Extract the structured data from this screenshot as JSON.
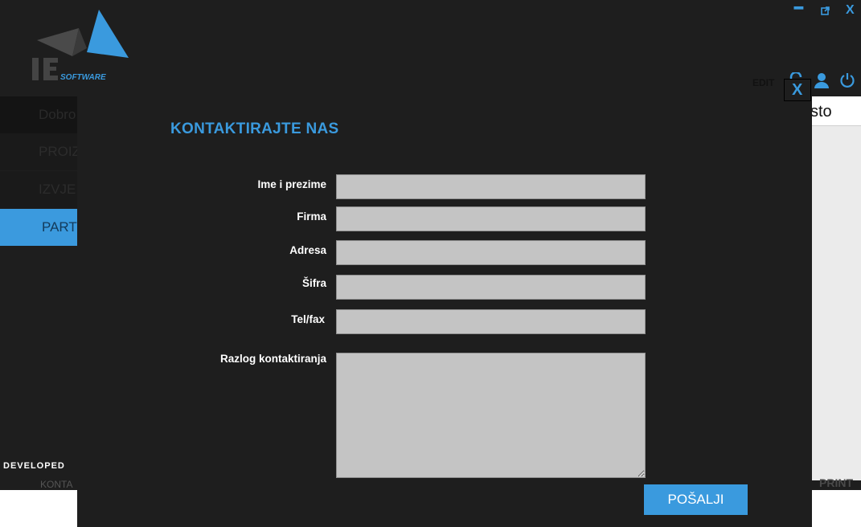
{
  "app": {
    "logo_text": "SOFTWARE",
    "logo_initials": "IE",
    "window_controls": {
      "minimize": "━",
      "maximize": "⧉",
      "close": "X"
    },
    "header": {
      "partial_label": "EDIT",
      "icons": [
        "lock-icon",
        "user-icon",
        "power-icon"
      ]
    },
    "sidebar": {
      "items": [
        {
          "label": "Dobro"
        },
        {
          "label": "PROIZ"
        },
        {
          "label": "IZVJE"
        },
        {
          "label": "PART"
        }
      ]
    },
    "right_panel_text": "sto",
    "print_label": "PRINT",
    "developed_label": "DEVELOPED",
    "kontakt_label": "KONTA"
  },
  "modal": {
    "title": "KONTAKTIRAJTE NAS",
    "close_label": "X",
    "fields": [
      {
        "label": "Ime i prezime",
        "value": ""
      },
      {
        "label": "Firma",
        "value": ""
      },
      {
        "label": "Adresa",
        "value": ""
      },
      {
        "label": "Šifra",
        "value": ""
      },
      {
        "label": "Tel/fax",
        "value": ""
      }
    ],
    "reason": {
      "label": "Razlog kontaktiranja",
      "value": ""
    },
    "send_label": "POŠALJI"
  },
  "colors": {
    "accent": "#3a9ade",
    "background": "#1e1e1e",
    "input": "#c4c4c4"
  }
}
